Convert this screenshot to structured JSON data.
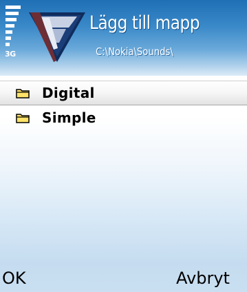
{
  "header": {
    "title": "Lägg till mapp",
    "path": "C:\\Nokia\\Sounds\\",
    "network": "3G",
    "signal_icon": "signal-strength-icon",
    "logo_icon": "operator-logo-icon"
  },
  "list": {
    "items": [
      {
        "label": "Digital",
        "icon": "folder-icon",
        "selected": true
      },
      {
        "label": "Simple",
        "icon": "folder-icon",
        "selected": false
      }
    ]
  },
  "softkeys": {
    "left": "OK",
    "right": "Avbryt"
  },
  "colors": {
    "header_blue": "#1f6fb6",
    "folder_yellow": "#ffe36a",
    "selection_gray": "#e2e2e2"
  }
}
